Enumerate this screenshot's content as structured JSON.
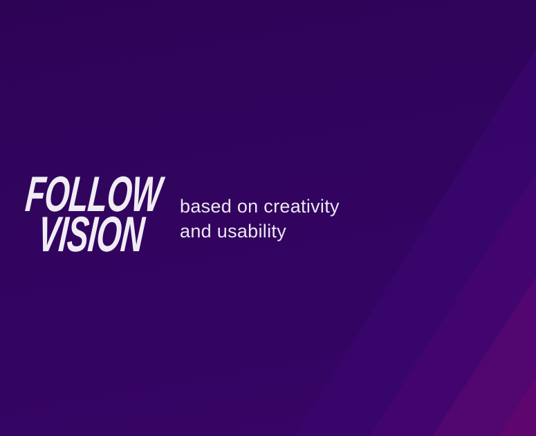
{
  "brand": {
    "line1": "FOLLOW",
    "line2": "VISION"
  },
  "tagline": {
    "line1": "based on creativity",
    "line2": "and usability"
  },
  "colors": {
    "background": "#320460",
    "band1": "#39066f",
    "band2": "#440672",
    "band3": "#530670",
    "band4": "#5e066f",
    "text": "#eeeaf2"
  }
}
